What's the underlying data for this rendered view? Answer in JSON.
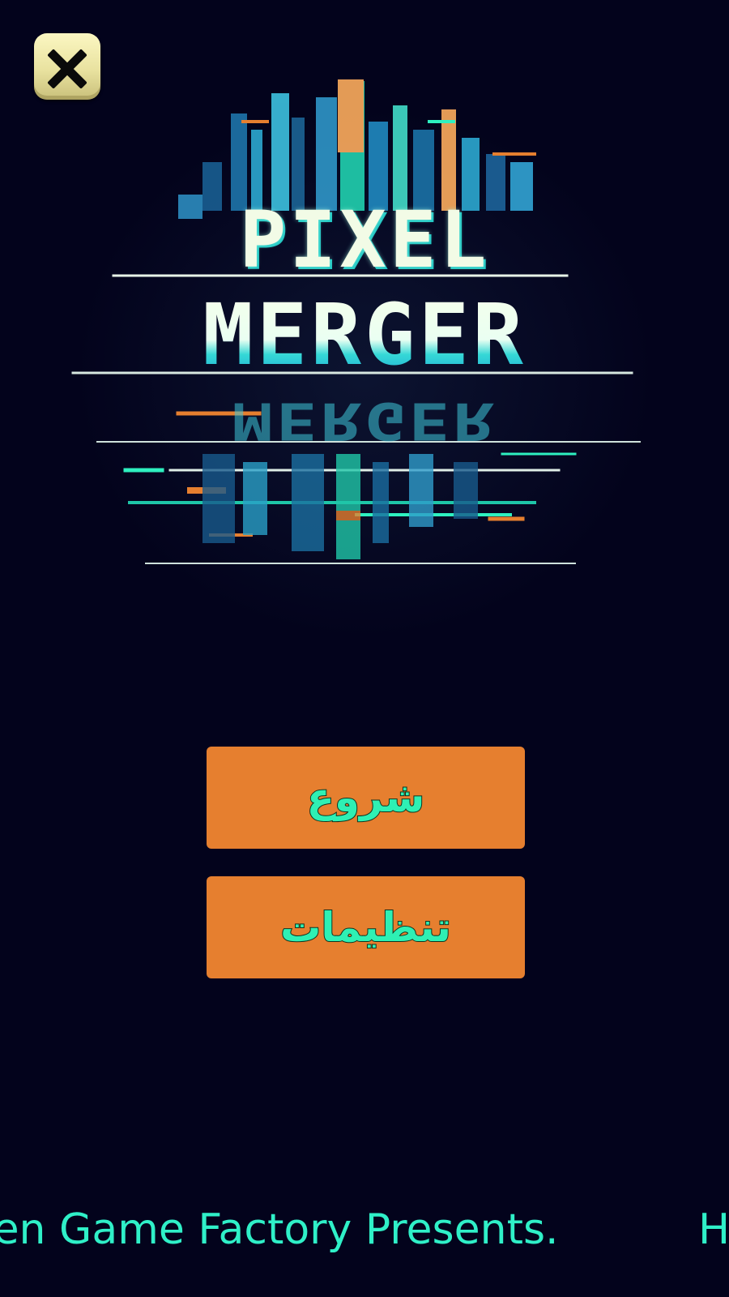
{
  "close_button": {
    "icon": "close-icon"
  },
  "logo": {
    "line1": "PIXEL",
    "line2": "MERGER",
    "reflection": "MERGER"
  },
  "menu": {
    "start_label": "شروع",
    "settings_label": "تنظیمات"
  },
  "ticker": {
    "text": "Hidden Game Factory Presents."
  },
  "colors": {
    "background": "#03031c",
    "button": "#e67f2f",
    "button_text": "#2ef0b4",
    "ticker_text": "#2ff0c8",
    "close_button": "#f3edb2"
  }
}
